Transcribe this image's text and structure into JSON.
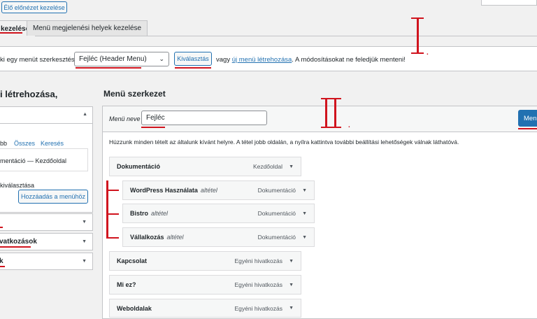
{
  "top": {
    "live_preview_button": "Élő előnézet kezelése"
  },
  "tabs": [
    {
      "label": "kezelése"
    },
    {
      "label": "Menü megjelenési helyek kezelése"
    }
  ],
  "select_bar": {
    "prefix": "ki egy menüt szerkesztésre:",
    "selected_menu": "Fejléc (Header Menu)",
    "select_button": "Kiválasztás",
    "or_text": "vagy",
    "create_link": "új menü létrehozása",
    "suffix": ". A módosításokat ne feledjük menteni!"
  },
  "annotations": {
    "roman_one": "I",
    "roman_one_dot": ".",
    "roman_two": "II",
    "roman_two_dot": "."
  },
  "left": {
    "heading": "i létrehozása,",
    "tabs": [
      "bb",
      "Összes",
      "Keresés"
    ],
    "page_item": "mentáció — Kezdőoldal",
    "select_all": "kiválasztása",
    "add_button": "Hozzáadás a menühöz",
    "accordions": [
      {
        "label": ""
      },
      {
        "label": "vatkozások"
      },
      {
        "label": "k"
      }
    ]
  },
  "right": {
    "heading": "Menü szerkezet",
    "menu_name_label": "Menü neve",
    "menu_name_value": "Fejléc",
    "save_button": "Menü",
    "instructions": "Húzzunk minden tételt az általunk kívánt helyre. A tétel jobb oldalán, a nyílra kattintva további beállítási lehetőségek válnak láthatóvá.",
    "items": [
      {
        "title": "Dokumentáció",
        "sub": "",
        "type": "Kezdőoldal"
      },
      {
        "title": "WordPress Használata",
        "sub": "altétel",
        "type": "Dokumentáció"
      },
      {
        "title": "Bistro",
        "sub": "altétel",
        "type": "Dokumentáció"
      },
      {
        "title": "Vállalkozás",
        "sub": "altétel",
        "type": "Dokumentáció"
      },
      {
        "title": "Kapcsolat",
        "sub": "",
        "type": "Egyéni hivatkozás"
      },
      {
        "title": "Mi ez?",
        "sub": "",
        "type": "Egyéni hivatkozás"
      },
      {
        "title": "Weboldalak",
        "sub": "",
        "type": "Egyéni hivatkozás"
      }
    ]
  },
  "colors": {
    "accent": "#2271b1",
    "annotation_red": "#d0141e",
    "primary_button": "#2271b1"
  }
}
